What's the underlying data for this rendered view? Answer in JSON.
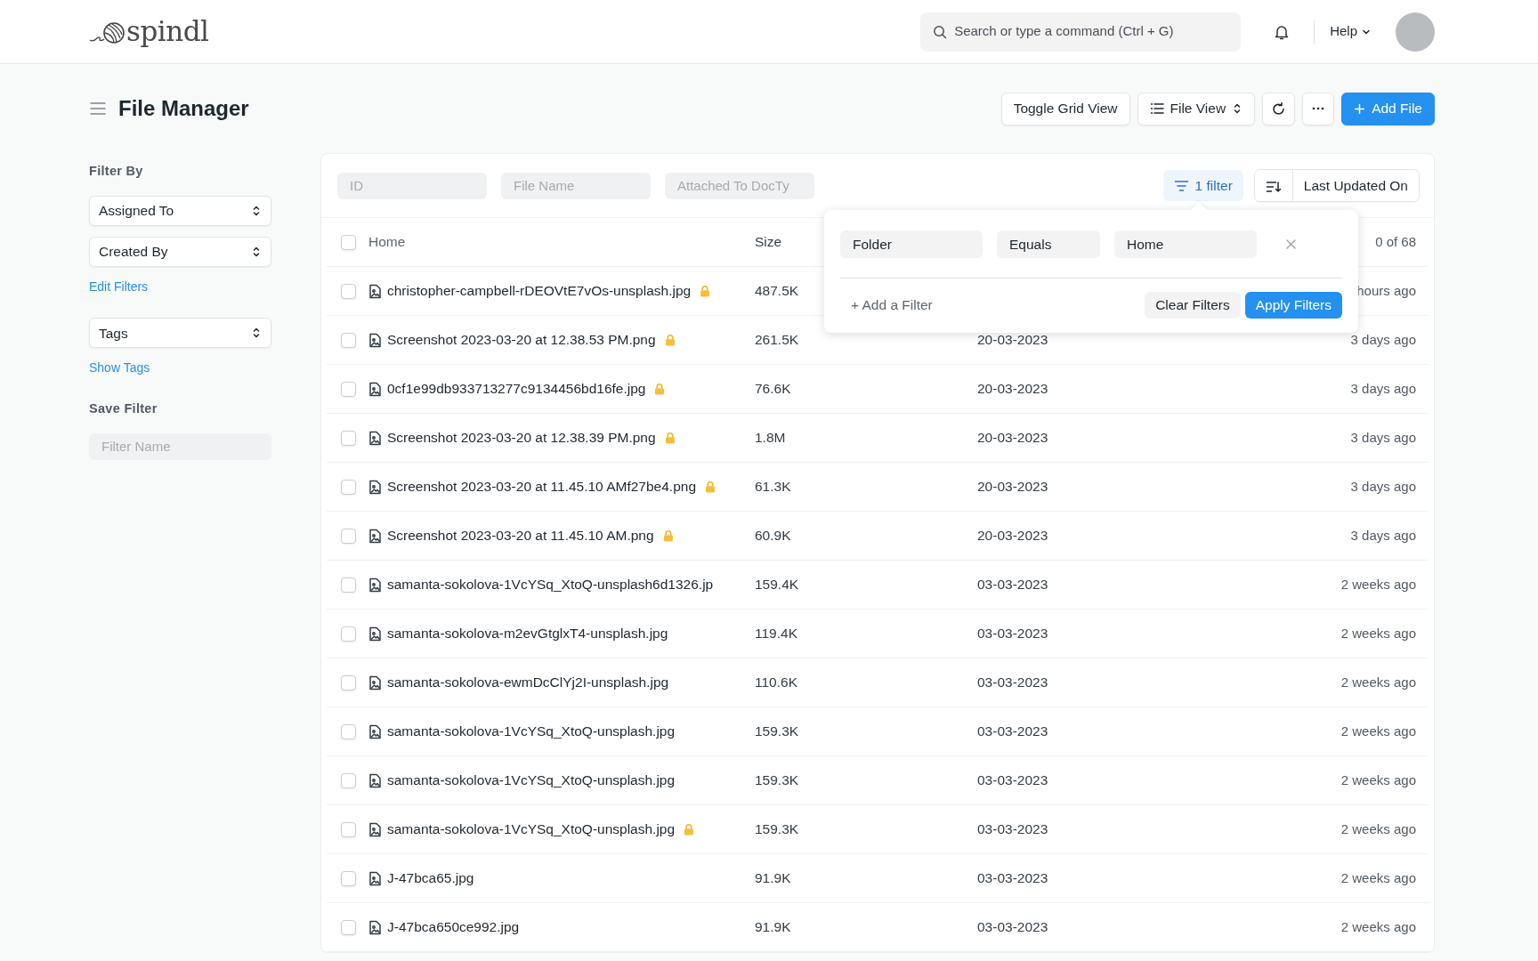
{
  "app": {
    "logo": "spindl"
  },
  "search": {
    "placeholder": "Search or type a command (Ctrl + G)"
  },
  "help": "Help",
  "page_title": "File Manager",
  "actions": [
    {
      "kind": "plain",
      "label": "Toggle Grid View"
    },
    {
      "kind": "view",
      "label": "File View"
    },
    {
      "kind": "refresh"
    },
    {
      "kind": "more"
    },
    {
      "kind": "primary",
      "label": "Add File"
    }
  ],
  "sidebar": {
    "heading": "Filter By",
    "items": [
      {
        "kind": "select",
        "label": "Assigned To"
      },
      {
        "kind": "select",
        "label": "Created By"
      },
      {
        "kind": "link",
        "label": "Edit Filters"
      },
      {
        "kind": "select",
        "label": "Tags"
      },
      {
        "kind": "link",
        "label": "Show Tags"
      }
    ],
    "save_heading": "Save Filter",
    "save_placeholder": "Filter Name"
  },
  "filter_bar": {
    "fields": [
      {
        "placeholder": "ID"
      },
      {
        "placeholder": "File Name"
      },
      {
        "placeholder": "Attached To DocTy"
      }
    ],
    "filter_button": "1 filter",
    "sort": "Last Updated On"
  },
  "filter_popup": {
    "rows": [
      {
        "field": "Folder",
        "condition": "Equals",
        "value": "Home"
      }
    ],
    "add": "+ Add a Filter",
    "clear": "Clear Filters",
    "apply": "Apply Filters"
  },
  "table": {
    "columns": [
      "Home",
      "Size"
    ],
    "all_checked": false,
    "count": "0 of 68",
    "rows": [
      {
        "name": "christopher-campbell-rDEOVtE7vOs-unsplash.jpg",
        "locked": true,
        "size": "487.5K",
        "modified": "hours ago",
        "checked": false
      },
      {
        "name": "Screenshot 2023-03-20 at 12.38.53 PM.png",
        "locked": true,
        "size": "261.5K",
        "date": "20-03-2023",
        "modified": "3 days ago",
        "checked": false
      },
      {
        "name": "0cf1e99db933713277c9134456bd16fe.jpg",
        "locked": true,
        "size": "76.6K",
        "date": "20-03-2023",
        "modified": "3 days ago",
        "checked": false
      },
      {
        "name": "Screenshot 2023-03-20 at 12.38.39 PM.png",
        "locked": true,
        "size": "1.8M",
        "date": "20-03-2023",
        "modified": "3 days ago",
        "checked": false
      },
      {
        "name": "Screenshot 2023-03-20 at 11.45.10 AMf27be4.png",
        "locked": true,
        "size": "61.3K",
        "date": "20-03-2023",
        "modified": "3 days ago",
        "checked": false
      },
      {
        "name": "Screenshot 2023-03-20 at 11.45.10 AM.png",
        "locked": true,
        "size": "60.9K",
        "date": "20-03-2023",
        "modified": "3 days ago",
        "checked": false
      },
      {
        "name": "samanta-sokolova-1VcYSq_XtoQ-unsplash6d1326.jp",
        "locked": false,
        "size": "159.4K",
        "date": "03-03-2023",
        "modified": "2 weeks ago",
        "checked": false
      },
      {
        "name": "samanta-sokolova-m2evGtglxT4-unsplash.jpg",
        "locked": false,
        "size": "119.4K",
        "date": "03-03-2023",
        "modified": "2 weeks ago",
        "checked": false
      },
      {
        "name": "samanta-sokolova-ewmDcClYj2I-unsplash.jpg",
        "locked": false,
        "size": "110.6K",
        "date": "03-03-2023",
        "modified": "2 weeks ago",
        "checked": false
      },
      {
        "name": "samanta-sokolova-1VcYSq_XtoQ-unsplash.jpg",
        "locked": false,
        "size": "159.3K",
        "date": "03-03-2023",
        "modified": "2 weeks ago",
        "checked": false
      },
      {
        "name": "samanta-sokolova-1VcYSq_XtoQ-unsplash.jpg",
        "locked": false,
        "size": "159.3K",
        "date": "03-03-2023",
        "modified": "2 weeks ago",
        "checked": false
      },
      {
        "name": "samanta-sokolova-1VcYSq_XtoQ-unsplash.jpg",
        "locked": true,
        "size": "159.3K",
        "date": "03-03-2023",
        "modified": "2 weeks ago",
        "checked": false
      },
      {
        "name": "J-47bca65.jpg",
        "locked": false,
        "size": "91.9K",
        "date": "03-03-2023",
        "modified": "2 weeks ago",
        "checked": false
      },
      {
        "name": "J-47bca650ce992.jpg",
        "locked": false,
        "size": "91.9K",
        "date": "03-03-2023",
        "modified": "2 weeks ago",
        "checked": false
      }
    ]
  }
}
